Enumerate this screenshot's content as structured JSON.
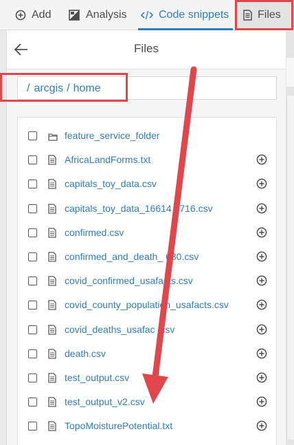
{
  "toolbar": {
    "tabs": [
      {
        "label": "Add",
        "icon": "plus-circle-icon"
      },
      {
        "label": "Analysis",
        "icon": "analysis-icon"
      },
      {
        "label": "Code snippets",
        "icon": "code-icon",
        "active": true
      },
      {
        "label": "Files",
        "icon": "file-icon"
      }
    ]
  },
  "panel": {
    "title": "Files",
    "breadcrumb": {
      "root": "/",
      "parts": [
        "arcgis",
        "home"
      ],
      "separator": "/"
    }
  },
  "files": [
    {
      "name": "feature_service_folder",
      "type": "folder",
      "icon": "folder-icon",
      "add_button": false
    },
    {
      "name": "AfricaLandForms.txt",
      "type": "file",
      "icon": "file-icon",
      "add_button": true
    },
    {
      "name": "capitals_toy_data.csv",
      "type": "file",
      "icon": "file-icon",
      "add_button": true
    },
    {
      "name": "capitals_toy_data_16614 0716.csv",
      "type": "file",
      "icon": "file-icon",
      "add_button": true
    },
    {
      "name": "confirmed.csv",
      "type": "file",
      "icon": "file-icon",
      "add_button": true
    },
    {
      "name": "confirmed_and_death_ 630.csv",
      "type": "file",
      "icon": "file-icon",
      "add_button": true
    },
    {
      "name": "covid_confirmed_usafacts.csv",
      "type": "file",
      "icon": "file-icon",
      "add_button": true
    },
    {
      "name": "covid_county_population_usafacts.csv",
      "type": "file",
      "icon": "file-icon",
      "add_button": true
    },
    {
      "name": "covid_deaths_usafac .csv",
      "type": "file",
      "icon": "file-icon",
      "add_button": true
    },
    {
      "name": "death.csv",
      "type": "file",
      "icon": "file-icon",
      "add_button": true
    },
    {
      "name": "test_output.csv",
      "type": "file",
      "icon": "file-icon",
      "add_button": true
    },
    {
      "name": "test_output_v2.csv",
      "type": "file",
      "icon": "file-icon",
      "add_button": true
    },
    {
      "name": "TopoMoisturePotential.txt",
      "type": "file",
      "icon": "file-icon",
      "add_button": true
    }
  ],
  "colors": {
    "accent": "#2f7ebf",
    "annotation": "#e0464b"
  }
}
